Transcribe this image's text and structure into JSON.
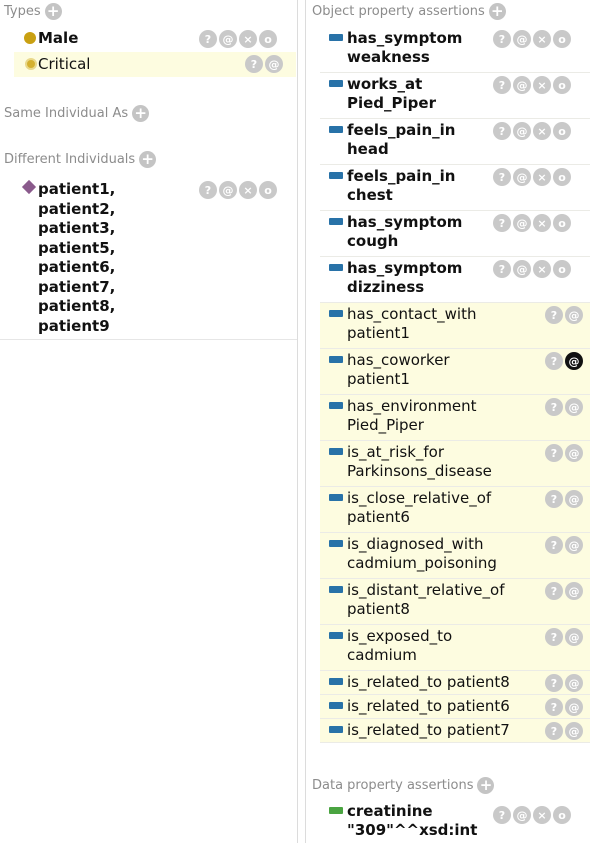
{
  "colors": {
    "type_dot": "#c9a012",
    "type_dot_inferred": "#d4b02f",
    "individual_diamond": "#8a5a8c",
    "object_property_bar": "#2872a8",
    "data_property_bar": "#4aa441",
    "inferred_row_bg": "#fdfce0"
  },
  "types": {
    "header": "Types",
    "items": [
      {
        "label": "Male",
        "inferred": false
      },
      {
        "label": "Critical",
        "inferred": true
      }
    ]
  },
  "same_individual": {
    "header": "Same Individual As"
  },
  "different_individuals": {
    "header": "Different Individuals",
    "lines": [
      "patient1,",
      "patient2,",
      "patient3,",
      "patient5,",
      "patient6,",
      "patient7,",
      "patient8,",
      "patient9"
    ]
  },
  "object_properties": {
    "header": "Object property assertions",
    "asserted": [
      {
        "line1": "has_symptom",
        "line2": "weakness"
      },
      {
        "line1": "works_at",
        "line2": "Pied_Piper"
      },
      {
        "line1": "feels_pain_in",
        "line2": "head"
      },
      {
        "line1": "feels_pain_in",
        "line2": "chest"
      },
      {
        "line1": "has_symptom",
        "line2": "cough"
      },
      {
        "line1": "has_symptom",
        "line2": "dizziness"
      }
    ],
    "inferred": [
      {
        "line1": "has_contact_with",
        "line2": "patient1"
      },
      {
        "line1": "has_coworker",
        "line2": "patient1"
      },
      {
        "line1": "has_environment",
        "line2": "Pied_Piper"
      },
      {
        "line1": "is_at_risk_for",
        "line2": "Parkinsons_disease"
      },
      {
        "line1": "is_close_relative_of",
        "line2": "patient6"
      },
      {
        "line1": "is_diagnosed_with",
        "line2": "cadmium_poisoning"
      },
      {
        "line1": "is_distant_relative_of",
        "line2": "patient8"
      },
      {
        "line1": "is_exposed_to",
        "line2": "cadmium"
      }
    ],
    "inferred_single": [
      {
        "text": "is_related_to  patient8"
      },
      {
        "text": "is_related_to  patient6"
      },
      {
        "text": "is_related_to  patient7"
      }
    ]
  },
  "data_properties": {
    "header": "Data property assertions",
    "items": [
      {
        "line1": "creatinine",
        "line2": "\"309\"^^xsd:int"
      }
    ]
  },
  "buttons": {
    "explain": "?",
    "annotate": "@",
    "delete": "×",
    "edit": "o"
  }
}
